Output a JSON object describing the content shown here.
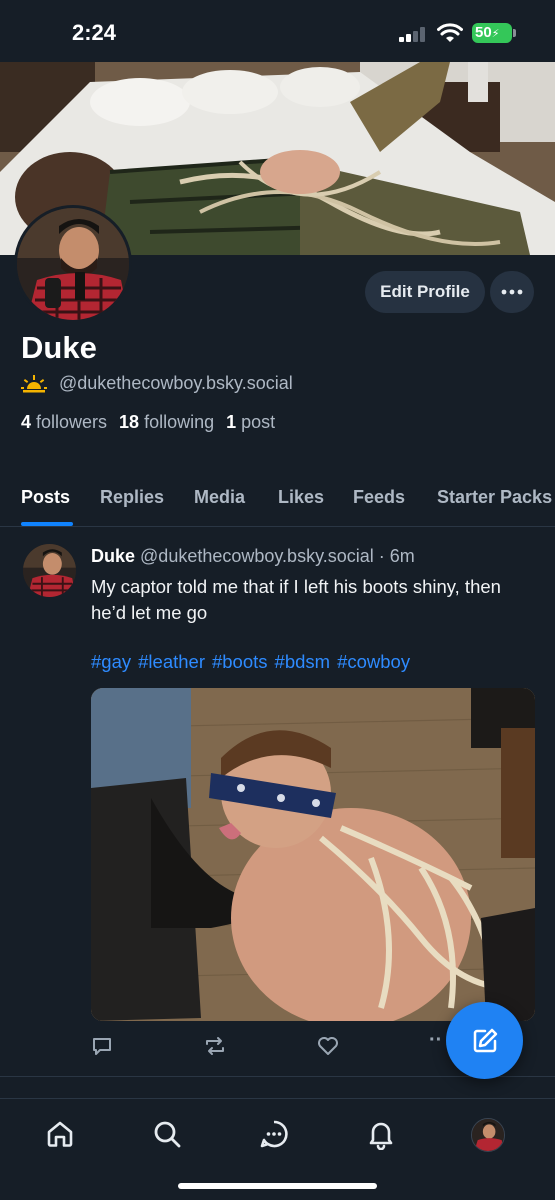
{
  "status_bar": {
    "time": "2:24",
    "battery": "50"
  },
  "profile": {
    "display_name": "Duke",
    "handle": "@dukethecowboy.bsky.social",
    "followers_count": "4",
    "followers_label": "followers",
    "following_count": "18",
    "following_label": "following",
    "posts_count": "1",
    "posts_label": "post",
    "edit_label": "Edit Profile",
    "more_label": "···"
  },
  "tabs": [
    {
      "label": "Posts",
      "active": true
    },
    {
      "label": "Replies"
    },
    {
      "label": "Media"
    },
    {
      "label": "Likes"
    },
    {
      "label": "Feeds"
    },
    {
      "label": "Starter Packs"
    }
  ],
  "post": {
    "author": "Duke",
    "handle": "@dukethecowboy.bsky.social",
    "time": "· 6m",
    "text": "My captor told me that if I left his boots shiny, then he’d let me go",
    "hashtags": [
      "#gay",
      "#leather",
      "#boots",
      "#bdsm",
      "#cowboy"
    ],
    "more_label": "··"
  },
  "nav": {
    "items": [
      "home-icon",
      "search-icon",
      "chat-icon",
      "notifications-icon",
      "profile-avatar"
    ]
  },
  "colors": {
    "background": "#161e27",
    "accent": "#1083fe",
    "hashtag": "#2e8bff",
    "muted_text": "#aeb8c4",
    "button_bg": "#263241",
    "battery": "#34c759"
  }
}
